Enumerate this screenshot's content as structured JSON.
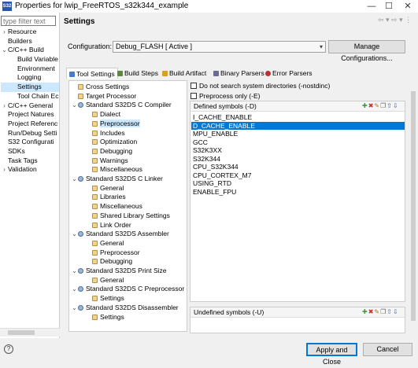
{
  "window": {
    "title": "Properties for lwip_FreeRTOS_s32k344_example",
    "app_icon_text": "S32",
    "minimize": "—",
    "maximize": "☐",
    "close": "✕"
  },
  "left": {
    "filter_placeholder": "type filter text",
    "items": [
      {
        "label": "Resource",
        "twisty": "›",
        "indent": 0,
        "selected": false
      },
      {
        "label": "Builders",
        "twisty": "",
        "indent": 0,
        "selected": false
      },
      {
        "label": "C/C++ Build",
        "twisty": "⌄",
        "indent": 0,
        "selected": false
      },
      {
        "label": "Build Variable",
        "twisty": "",
        "indent": 1,
        "selected": false
      },
      {
        "label": "Environment",
        "twisty": "",
        "indent": 1,
        "selected": false
      },
      {
        "label": "Logging",
        "twisty": "",
        "indent": 1,
        "selected": false
      },
      {
        "label": "Settings",
        "twisty": "",
        "indent": 1,
        "selected": true
      },
      {
        "label": "Tool Chain Ec",
        "twisty": "",
        "indent": 1,
        "selected": false
      },
      {
        "label": "C/C++ General",
        "twisty": "›",
        "indent": 0,
        "selected": false
      },
      {
        "label": "Project Natures",
        "twisty": "",
        "indent": 0,
        "selected": false
      },
      {
        "label": "Project Referenc",
        "twisty": "",
        "indent": 0,
        "selected": false
      },
      {
        "label": "Run/Debug Setti",
        "twisty": "",
        "indent": 0,
        "selected": false
      },
      {
        "label": "S32 Configurati",
        "twisty": "",
        "indent": 0,
        "selected": false
      },
      {
        "label": "SDKs",
        "twisty": "",
        "indent": 0,
        "selected": false
      },
      {
        "label": "Task Tags",
        "twisty": "",
        "indent": 0,
        "selected": false
      },
      {
        "label": "Validation",
        "twisty": "›",
        "indent": 0,
        "selected": false
      }
    ]
  },
  "header": {
    "title": "Settings",
    "nav_icons": "⇦ ▾ ⇨ ▾ ⋮"
  },
  "config": {
    "label": "Configuration:",
    "value": "Debug_FLASH  [ Active ]",
    "manage_button": "Manage Configurations..."
  },
  "tabs": [
    {
      "label": "Tool Settings",
      "color": "#4a7bbf",
      "active": true
    },
    {
      "label": "Build Steps",
      "color": "#5a8a3a",
      "active": false
    },
    {
      "label": "Build Artifact",
      "color": "#d8a020",
      "active": false
    },
    {
      "label": "Binary Parsers",
      "color": "#6a6a9a",
      "active": false
    },
    {
      "label": "Error Parsers",
      "color": "#c03030",
      "active": false
    }
  ],
  "tool_tree": [
    {
      "label": "Cross Settings",
      "level": 0,
      "group": false,
      "twisty": "",
      "selected": false
    },
    {
      "label": "Target Processor",
      "level": 0,
      "group": false,
      "twisty": "",
      "selected": false
    },
    {
      "label": "Standard S32DS C Compiler",
      "level": 0,
      "group": true,
      "twisty": "⌄",
      "selected": false
    },
    {
      "label": "Dialect",
      "level": 1,
      "group": false,
      "twisty": "",
      "selected": false
    },
    {
      "label": "Preprocessor",
      "level": 1,
      "group": false,
      "twisty": "",
      "selected": true
    },
    {
      "label": "Includes",
      "level": 1,
      "group": false,
      "twisty": "",
      "selected": false
    },
    {
      "label": "Optimization",
      "level": 1,
      "group": false,
      "twisty": "",
      "selected": false
    },
    {
      "label": "Debugging",
      "level": 1,
      "group": false,
      "twisty": "",
      "selected": false
    },
    {
      "label": "Warnings",
      "level": 1,
      "group": false,
      "twisty": "",
      "selected": false
    },
    {
      "label": "Miscellaneous",
      "level": 1,
      "group": false,
      "twisty": "",
      "selected": false
    },
    {
      "label": "Standard S32DS C Linker",
      "level": 0,
      "group": true,
      "twisty": "⌄",
      "selected": false
    },
    {
      "label": "General",
      "level": 1,
      "group": false,
      "twisty": "",
      "selected": false
    },
    {
      "label": "Libraries",
      "level": 1,
      "group": false,
      "twisty": "",
      "selected": false
    },
    {
      "label": "Miscellaneous",
      "level": 1,
      "group": false,
      "twisty": "",
      "selected": false
    },
    {
      "label": "Shared Library Settings",
      "level": 1,
      "group": false,
      "twisty": "",
      "selected": false
    },
    {
      "label": "Link Order",
      "level": 1,
      "group": false,
      "twisty": "",
      "selected": false
    },
    {
      "label": "Standard S32DS Assembler",
      "level": 0,
      "group": true,
      "twisty": "⌄",
      "selected": false
    },
    {
      "label": "General",
      "level": 1,
      "group": false,
      "twisty": "",
      "selected": false
    },
    {
      "label": "Preprocessor",
      "level": 1,
      "group": false,
      "twisty": "",
      "selected": false
    },
    {
      "label": "Debugging",
      "level": 1,
      "group": false,
      "twisty": "",
      "selected": false
    },
    {
      "label": "Standard S32DS Print Size",
      "level": 0,
      "group": true,
      "twisty": "⌄",
      "selected": false
    },
    {
      "label": "General",
      "level": 1,
      "group": false,
      "twisty": "",
      "selected": false
    },
    {
      "label": "Standard S32DS C Preprocessor",
      "level": 0,
      "group": true,
      "twisty": "⌄",
      "selected": false
    },
    {
      "label": "Settings",
      "level": 1,
      "group": false,
      "twisty": "",
      "selected": false
    },
    {
      "label": "Standard S32DS Disassembler",
      "level": 0,
      "group": true,
      "twisty": "⌄",
      "selected": false
    },
    {
      "label": "Settings",
      "level": 1,
      "group": false,
      "twisty": "",
      "selected": false
    }
  ],
  "options": {
    "no_sys_dirs": "Do not search system directories (-nostdinc)",
    "preprocess_only": "Preprocess only (-E)"
  },
  "defined": {
    "title": "Defined symbols (-D)",
    "symbols": [
      {
        "text": "I_CACHE_ENABLE",
        "selected": false
      },
      {
        "text": "D_CACHE_ENABLE",
        "selected": true
      },
      {
        "text": "MPU_ENABLE",
        "selected": false
      },
      {
        "text": "GCC",
        "selected": false
      },
      {
        "text": "S32K3XX",
        "selected": false
      },
      {
        "text": "S32K344",
        "selected": false
      },
      {
        "text": "CPU_S32K344",
        "selected": false
      },
      {
        "text": "CPU_CORTEX_M7",
        "selected": false
      },
      {
        "text": "USING_RTD",
        "selected": false
      },
      {
        "text": "ENABLE_FPU",
        "selected": false
      }
    ]
  },
  "undefined": {
    "title": "Undefined symbols (-U)"
  },
  "list_toolbar_icons": [
    {
      "name": "add-symbol-icon",
      "glyph": "✚",
      "color": "#3a9a3a"
    },
    {
      "name": "delete-symbol-icon",
      "glyph": "✖",
      "color": "#c03030"
    },
    {
      "name": "edit-symbol-icon",
      "glyph": "✎",
      "color": "#b07a20"
    },
    {
      "name": "copy-symbol-icon",
      "glyph": "❐",
      "color": "#666666"
    },
    {
      "name": "move-up-icon",
      "glyph": "⇧",
      "color": "#2a6ab0"
    },
    {
      "name": "move-down-icon",
      "glyph": "⇩",
      "color": "#2a6ab0"
    }
  ],
  "footer": {
    "help": "?",
    "apply_close": "Apply and Close",
    "cancel": "Cancel"
  }
}
